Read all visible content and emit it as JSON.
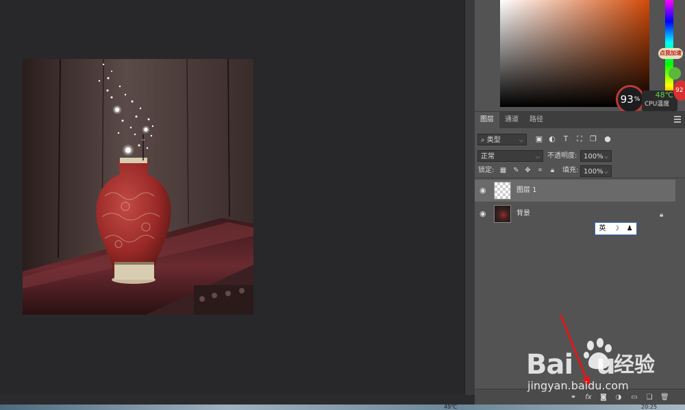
{
  "panel": {
    "tabs": [
      {
        "label": "图层",
        "active": true
      },
      {
        "label": "通道",
        "active": false
      },
      {
        "label": "路径",
        "active": false
      }
    ],
    "filter": {
      "label": "类型",
      "icon": "search-icon"
    },
    "blend_mode": "正常",
    "opacity_label": "不透明度:",
    "opacity_value": "100%",
    "lock_label": "锁定:",
    "fill_label": "填充:",
    "fill_value": "100%",
    "layers": [
      {
        "name": "图层 1",
        "selected": true,
        "visible": true,
        "locked": false
      },
      {
        "name": "背景",
        "selected": false,
        "visible": true,
        "locked": true
      }
    ]
  },
  "cpu_widget": {
    "usage": "93",
    "usage_unit": "%",
    "temp": "48℃",
    "label": "CPU温度",
    "corner_number": "92"
  },
  "speed_badge": "点我加速",
  "ime": {
    "language": "英",
    "moon": "☽",
    "user": "♟"
  },
  "watermark": {
    "logo_text": "Bai",
    "logo_text_end": "u",
    "chinese": "经验",
    "url": "jingyan.baidu.com"
  },
  "taskbar": {
    "temp": "49℃",
    "clock": "20:25"
  },
  "colors": {
    "panel_bg": "#535353",
    "canvas_bg": "#28272a",
    "accent_red": "#c03838",
    "color_field_hue": "#d24a08"
  }
}
